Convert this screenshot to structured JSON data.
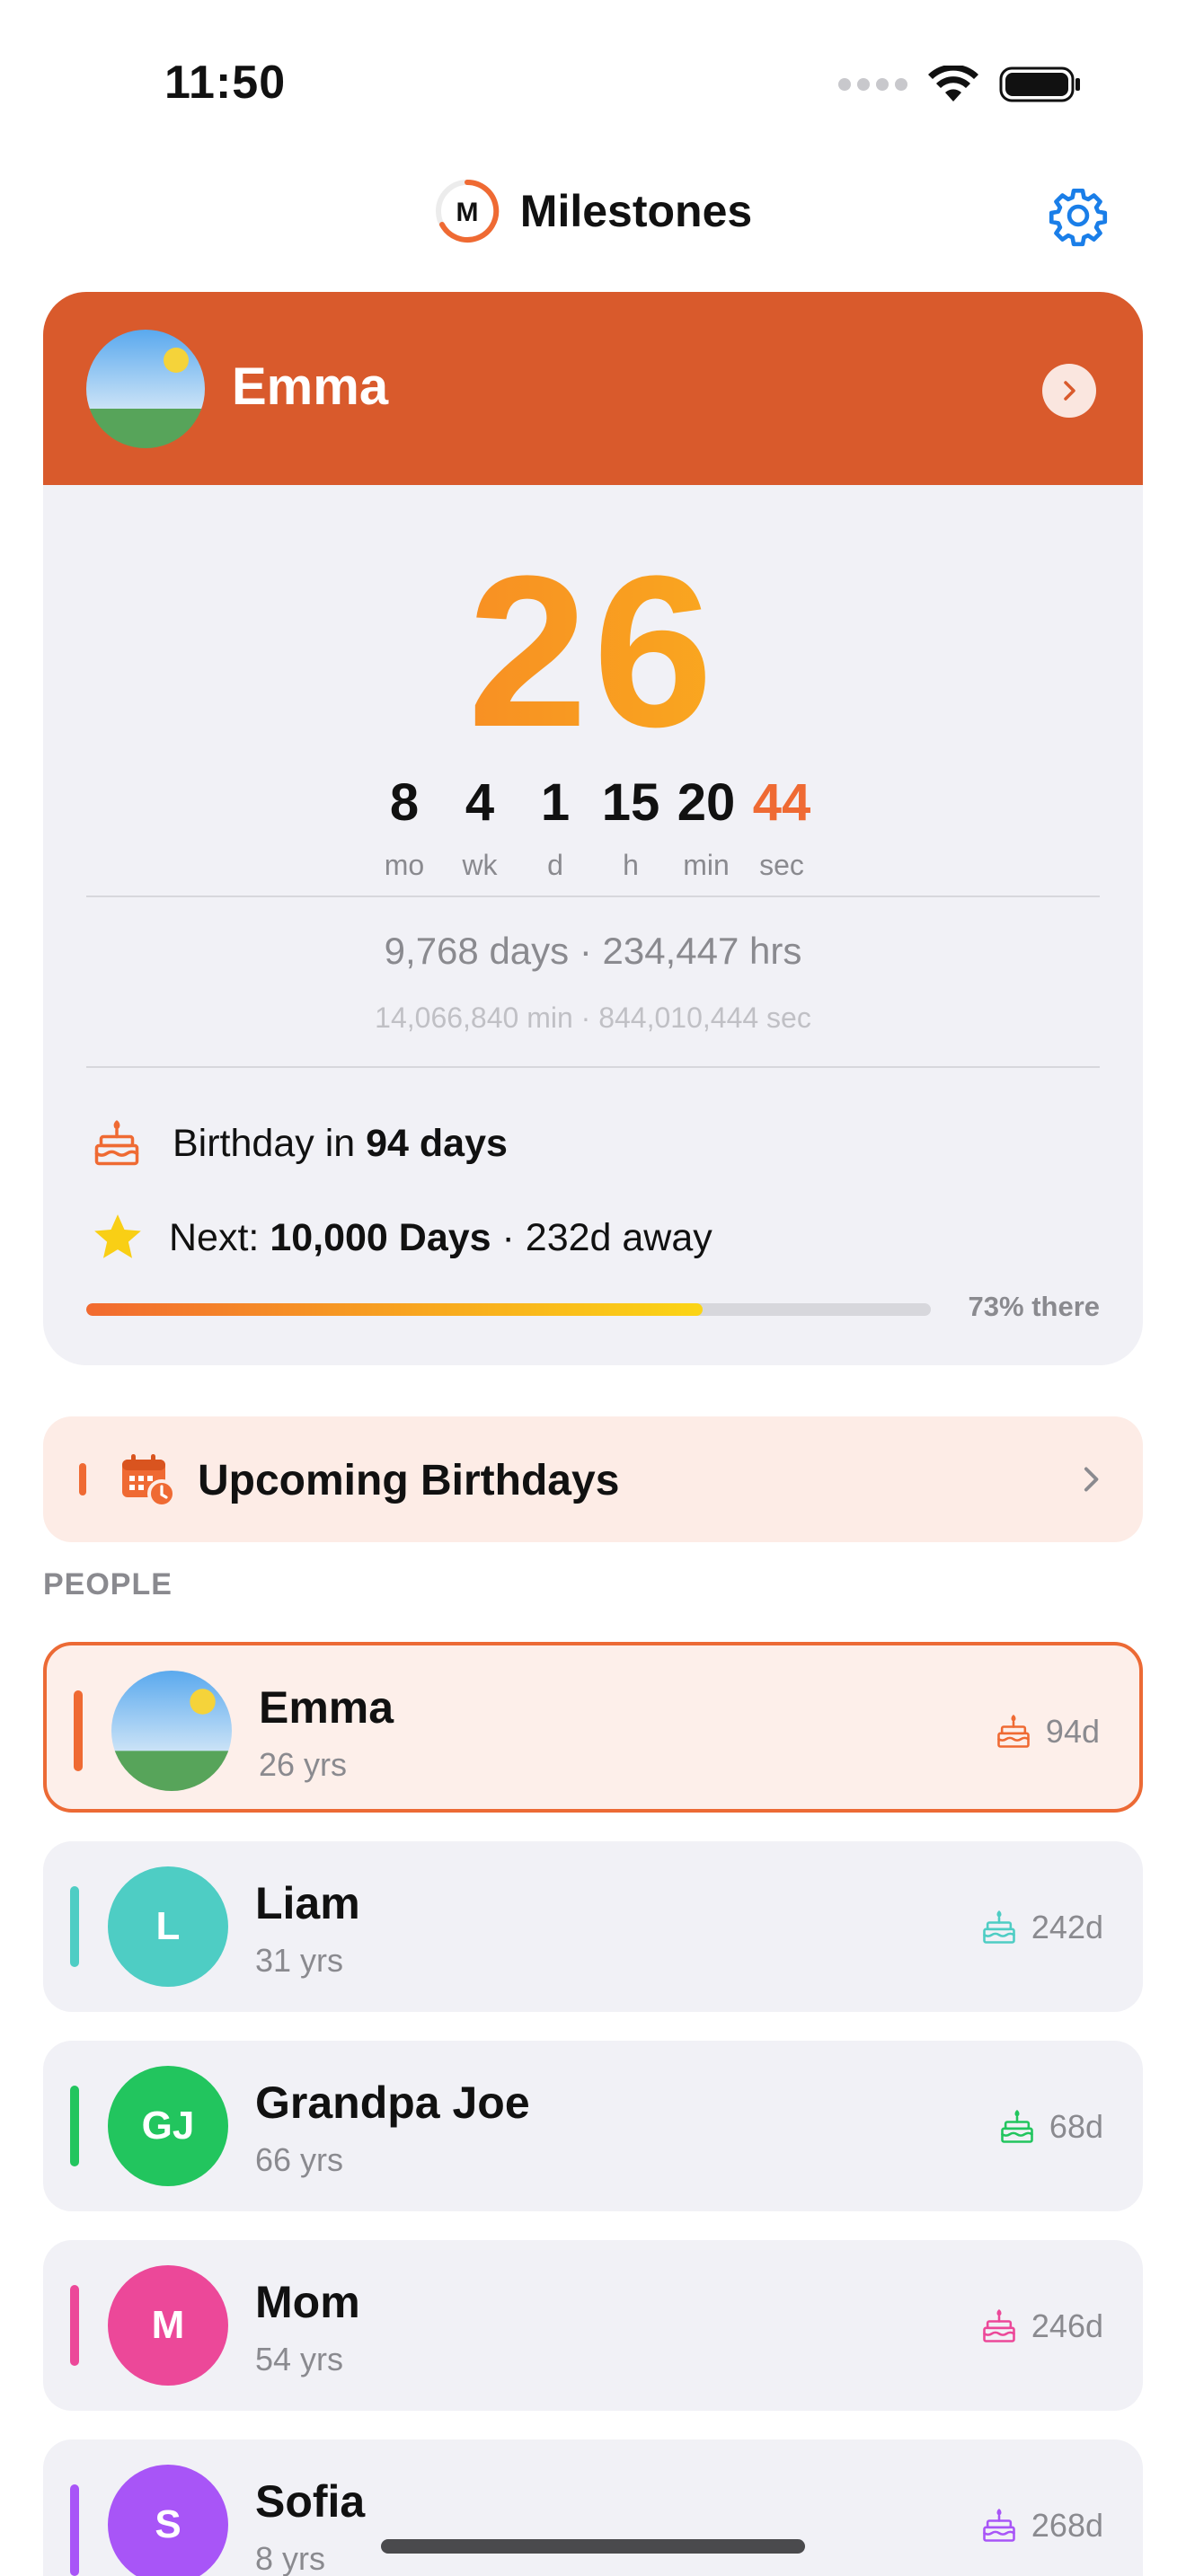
{
  "status_bar": {
    "time": "11:50"
  },
  "nav": {
    "title": "Milestones",
    "logo_letter": "M"
  },
  "hero": {
    "name": "Emma",
    "age": "26",
    "units": [
      {
        "value": "8",
        "label": "mo"
      },
      {
        "value": "4",
        "label": "wk"
      },
      {
        "value": "1",
        "label": "d"
      },
      {
        "value": "15",
        "label": "h"
      },
      {
        "value": "20",
        "label": "min"
      },
      {
        "value": "44",
        "label": "sec"
      }
    ],
    "totals_primary": "9,768 days · 234,447 hrs",
    "totals_secondary": "14,066,840 min · 844,010,444 sec",
    "birthday_prefix": "Birthday in ",
    "birthday_value": "94 days",
    "next_prefix": "Next: ",
    "next_value": "10,000 Days",
    "next_suffix": " · 232d away",
    "progress_fraction": 0.73,
    "progress_label": "73% there"
  },
  "upcoming": {
    "label": "Upcoming Birthdays"
  },
  "section": {
    "people_header": "PEOPLE"
  },
  "people": [
    {
      "name": "Emma",
      "age": "26 yrs",
      "days": "94d",
      "initials": "",
      "color": "#ef6a33"
    },
    {
      "name": "Liam",
      "age": "31 yrs",
      "days": "242d",
      "initials": "L",
      "color": "#4ecdc4"
    },
    {
      "name": "Grandpa Joe",
      "age": "66 yrs",
      "days": "68d",
      "initials": "GJ",
      "color": "#22c55e"
    },
    {
      "name": "Mom",
      "age": "54 yrs",
      "days": "246d",
      "initials": "M",
      "color": "#ec4899"
    },
    {
      "name": "Sofia",
      "age": "8 yrs",
      "days": "268d",
      "initials": "S",
      "color": "#a855f7"
    }
  ],
  "colors": {
    "accent": "#d95a2c",
    "settings": "#1a7ee8"
  },
  "icons": [
    "wifi-icon",
    "battery-icon",
    "gear-icon",
    "chevron-right-icon",
    "cake-icon",
    "star-icon",
    "calendar-clock-icon"
  ]
}
